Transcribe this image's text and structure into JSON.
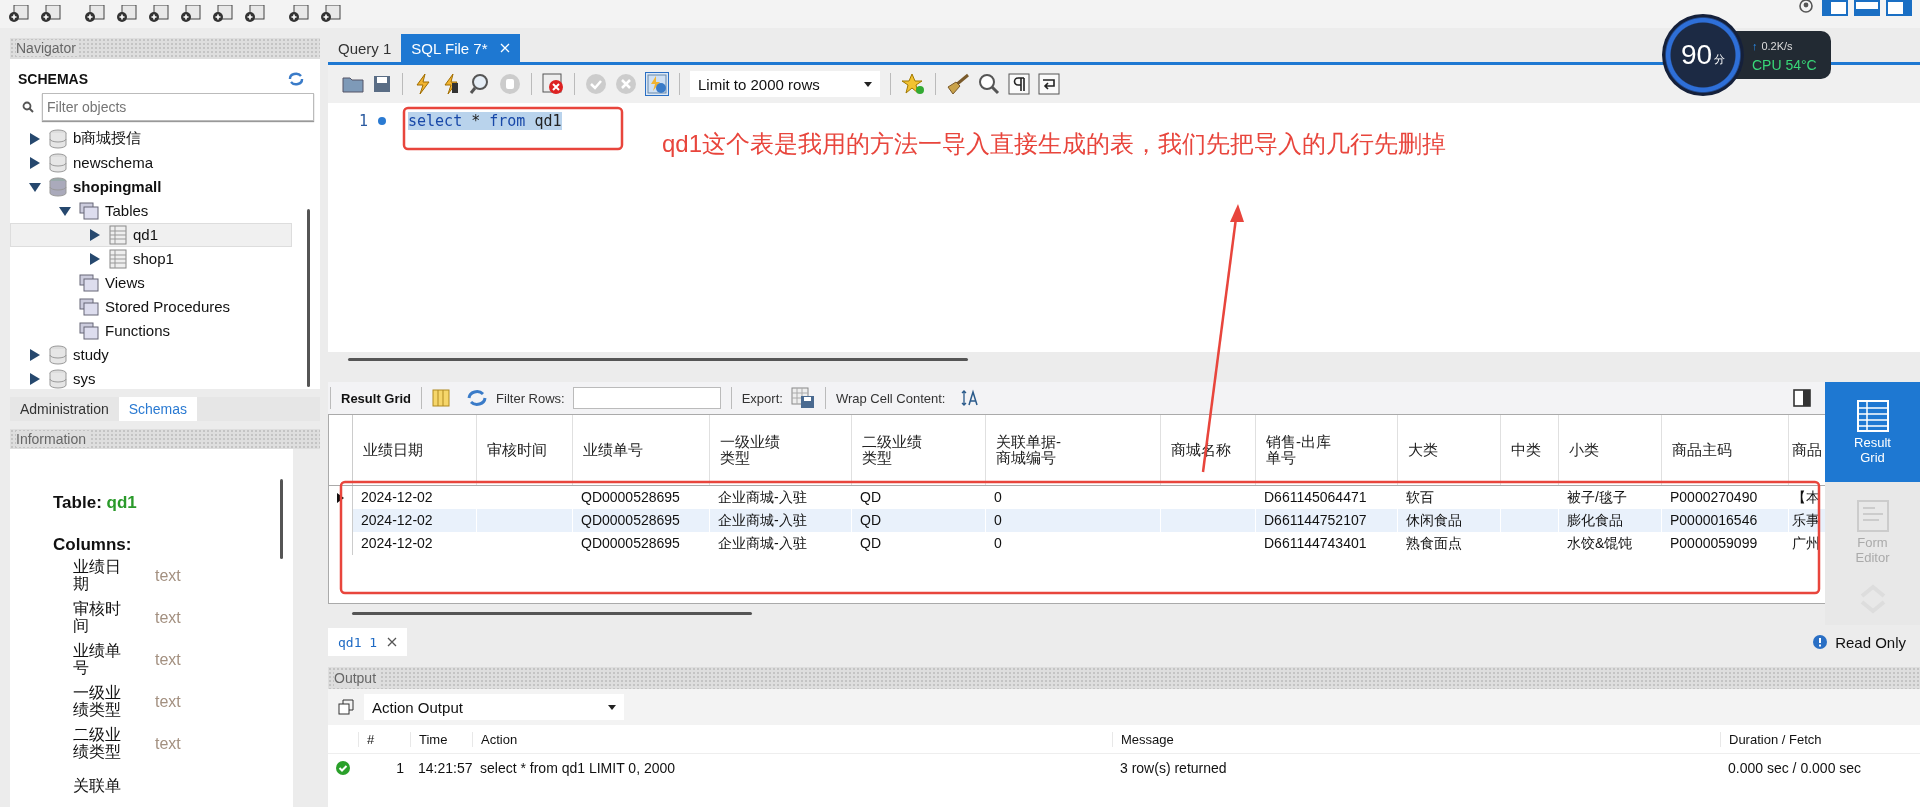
{
  "navigator": {
    "title": "Navigator",
    "section": "SCHEMAS",
    "filter": {
      "placeholder": "Filter objects"
    },
    "tree": [
      {
        "label": "b商城授信",
        "kind": "schema",
        "expanded": false,
        "active": false,
        "selected": false
      },
      {
        "label": "newschema",
        "kind": "schema",
        "expanded": false,
        "active": false,
        "selected": false
      },
      {
        "label": "shopingmall",
        "kind": "schema",
        "expanded": true,
        "active": true,
        "selected": false,
        "children": [
          {
            "label": "Tables",
            "kind": "folder",
            "expanded": true,
            "selected": false,
            "children": [
              {
                "label": "qd1",
                "kind": "table",
                "expanded": false,
                "selected": true
              },
              {
                "label": "shop1",
                "kind": "table",
                "expanded": false,
                "selected": false
              }
            ]
          },
          {
            "label": "Views",
            "kind": "folder",
            "selected": false
          },
          {
            "label": "Stored Procedures",
            "kind": "folder",
            "selected": false
          },
          {
            "label": "Functions",
            "kind": "folder",
            "selected": false
          }
        ]
      },
      {
        "label": "study",
        "kind": "schema",
        "expanded": false,
        "active": false,
        "selected": false
      },
      {
        "label": "sys",
        "kind": "schema",
        "expanded": false,
        "active": false,
        "selected": false
      }
    ]
  },
  "left_tabs": [
    {
      "label": "Administration",
      "selected": false
    },
    {
      "label": "Schemas",
      "selected": true
    }
  ],
  "information": {
    "title": "Information",
    "table_label": "Table:",
    "table_name": "qd1",
    "columns_label": "Columns:",
    "columns": [
      {
        "name": "业绩日期",
        "type": "text"
      },
      {
        "name": "审核时间",
        "type": "text"
      },
      {
        "name": "业绩单号",
        "type": "text"
      },
      {
        "name": "一级业绩类型",
        "type": "text"
      },
      {
        "name": "二级业绩类型",
        "type": "text"
      },
      {
        "name": "关联单"
      }
    ]
  },
  "editor_tabs": [
    {
      "label": "Query 1",
      "selected": false,
      "closable": false
    },
    {
      "label": "SQL File 7*",
      "selected": true,
      "closable": true
    }
  ],
  "editor": {
    "autocommit": true,
    "limit": "Limit to 2000 rows",
    "lines": [
      {
        "number": "1",
        "selected": true,
        "tokens": [
          {
            "text": "select",
            "kind": "keyword"
          },
          {
            "text": " * ",
            "kind": "plain"
          },
          {
            "text": "from",
            "kind": "keyword"
          },
          {
            "text": " qd1",
            "kind": "plain"
          }
        ]
      }
    ]
  },
  "annotation": {
    "text": "qd1这个表是我用的方法一导入直接生成的表，我们先把导入的几行先删掉"
  },
  "result": {
    "grid_label": "Result Grid",
    "filter_label": "Filter Rows:",
    "export_label": "Export:",
    "wrap_label": "Wrap Cell Content:",
    "columns": [
      "业绩日期",
      "审核时间",
      "业绩单号",
      "一级业绩类型",
      "二级业绩类型",
      "关联单据-商城编号",
      "商城名称",
      "销售-出库单号",
      "大类",
      "中类",
      "小类",
      "商品主码",
      "商品"
    ],
    "rows": [
      {
        "current": true,
        "cells": [
          "2024-12-02",
          null,
          "QD0000528695",
          "企业商城-入驻",
          "QD",
          "0",
          null,
          "D661145064471",
          "软百",
          null,
          "被子/毯子",
          "P0000270490",
          "【本"
        ]
      },
      {
        "current": false,
        "cells": [
          "2024-12-02",
          null,
          "QD0000528695",
          "企业商城-入驻",
          "QD",
          "0",
          null,
          "D661144752107",
          "休闲食品",
          null,
          "膨化食品",
          "P0000016546",
          "乐事"
        ]
      },
      {
        "current": false,
        "cells": [
          "2024-12-02",
          null,
          "QD0000528695",
          "企业商城-入驻",
          "QD",
          "0",
          null,
          "D661144743401",
          "熟食面点",
          null,
          "水饺&馄饨",
          "P0000059099",
          "广州"
        ]
      }
    ]
  },
  "side_views": [
    {
      "label": "Result Grid",
      "selected": true
    },
    {
      "label": "Form Editor",
      "selected": false
    }
  ],
  "result_tabs": [
    {
      "label": "qd1 1",
      "selected": true
    }
  ],
  "read_only": "Read Only",
  "output": {
    "title": "Output",
    "mode": "Action Output",
    "columns": [
      "#",
      "Time",
      "Action",
      "Message",
      "Duration / Fetch"
    ],
    "rows": [
      {
        "success": true,
        "cells": [
          "1",
          "14:21:57",
          "select * from qd1 LIMIT 0, 2000",
          "3 row(s) returned",
          "0.000 sec / 0.000 sec"
        ]
      }
    ]
  },
  "monitor": {
    "score": "90",
    "unit": "分",
    "rate_arrow": "↑",
    "rate": "0.2K/s",
    "cpu": "CPU 54°C"
  }
}
